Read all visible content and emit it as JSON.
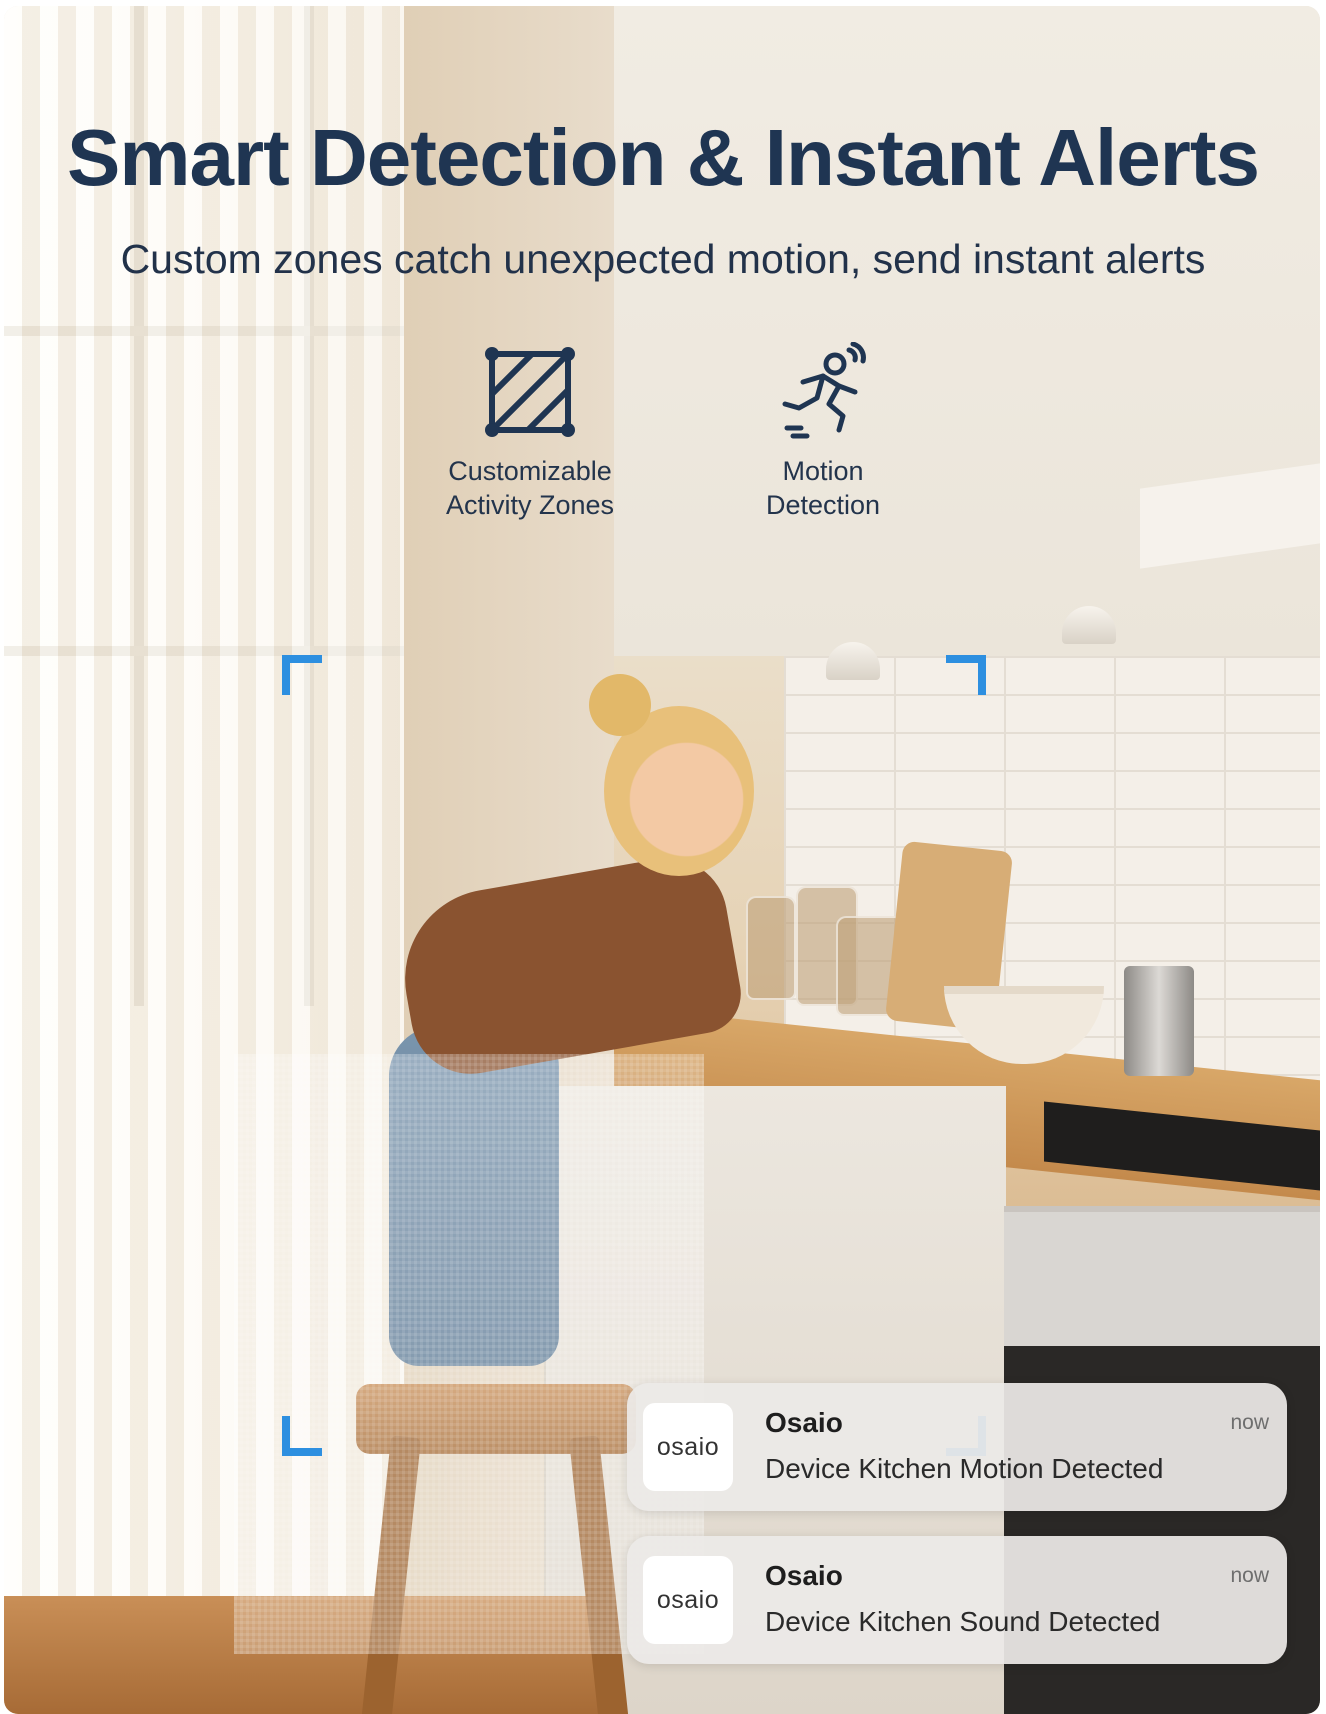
{
  "header": {
    "title": "Smart Detection & Instant Alerts",
    "subtitle": "Custom zones catch unexpected motion, send instant alerts"
  },
  "features": [
    {
      "icon": "activity-zone-icon",
      "line1": "Customizable",
      "line2": "Activity Zones"
    },
    {
      "icon": "running-person-motion-icon",
      "line1": "Motion",
      "line2": "Detection"
    }
  ],
  "notifications": [
    {
      "app_icon_text": "osaio",
      "app_name": "Osaio",
      "time": "now",
      "message": "Device Kitchen Motion Detected"
    },
    {
      "app_icon_text": "osaio",
      "app_name": "Osaio",
      "time": "now",
      "message": "Device Kitchen Sound Detected"
    }
  ],
  "colors": {
    "title": "#1f3552",
    "zone_corner": "#2d8fe0",
    "notification_bg": "#eceae7"
  }
}
